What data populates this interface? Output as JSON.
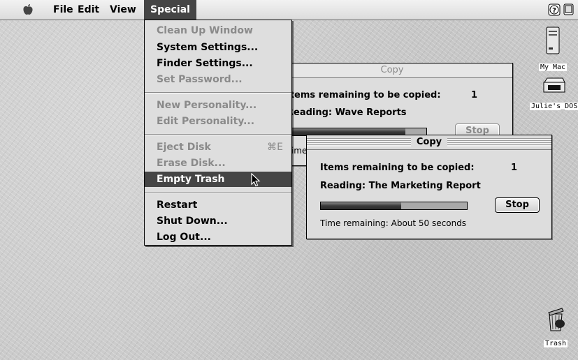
{
  "menubar": {
    "apple_icon": "apple-icon",
    "menus": [
      "File",
      "Edit",
      "View",
      "Special"
    ],
    "right_icons": [
      "help-icon",
      "application-menu-icon"
    ]
  },
  "special_menu": {
    "items": [
      {
        "label": "Clean Up Window",
        "enabled": false
      },
      {
        "label": "System Settings...",
        "enabled": true
      },
      {
        "label": "Finder Settings...",
        "enabled": true
      },
      {
        "label": "Set Password...",
        "enabled": false
      },
      {
        "label": "New Personality...",
        "enabled": false
      },
      {
        "label": "Edit Personality...",
        "enabled": false
      },
      {
        "label": "Eject Disk",
        "enabled": false,
        "shortcut": "⌘E"
      },
      {
        "label": "Erase Disk...",
        "enabled": false
      },
      {
        "label": "Empty Trash",
        "enabled": true,
        "highlighted": true
      },
      {
        "label": "Restart",
        "enabled": true
      },
      {
        "label": "Shut Down...",
        "enabled": true
      },
      {
        "label": "Log Out...",
        "enabled": true
      }
    ]
  },
  "copy_back": {
    "title": "Copy",
    "items_label": "Items remaining to be copied:",
    "items_count": "1",
    "reading": "Reading: Wave Reports",
    "stop_label": "Stop",
    "time_fragment": "Time",
    "progress": 0.85
  },
  "copy_front": {
    "title": "Copy",
    "items_label": "Items remaining to be copied:",
    "items_count": "1",
    "reading": "Reading: The Marketing Report",
    "stop_label": "Stop",
    "time_remaining": "Time remaining:  About 50 seconds",
    "progress": 0.55
  },
  "desktop_icons": [
    {
      "label": "My Mac",
      "icon": "computer-icon"
    },
    {
      "label": "Julie's_DOS",
      "icon": "disk-drive-icon"
    },
    {
      "label": "Trash",
      "icon": "trash-icon"
    }
  ]
}
